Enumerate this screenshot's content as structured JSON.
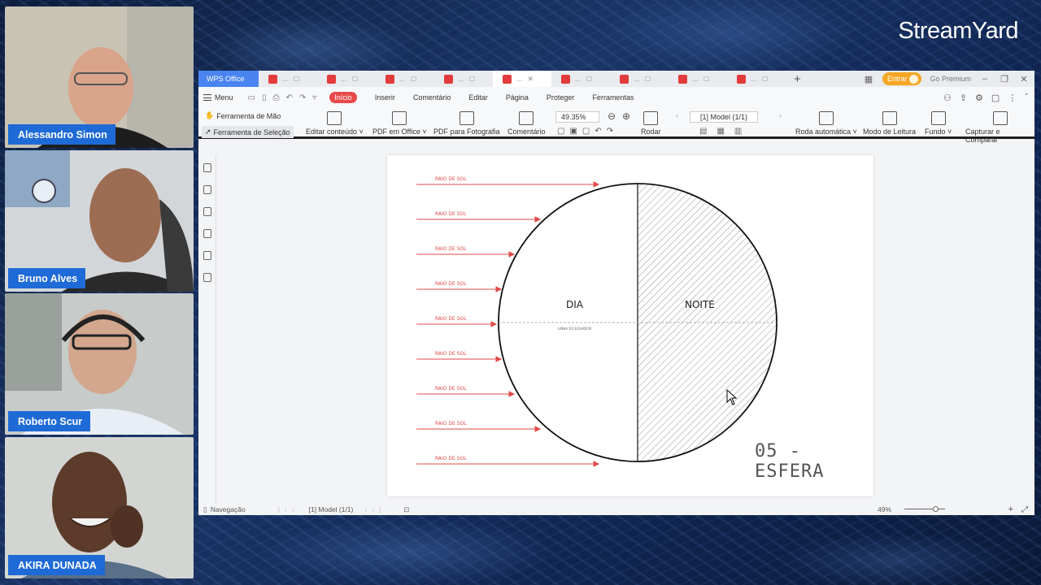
{
  "brand": "StreamYard",
  "participants": [
    {
      "name": "Alessandro Simon"
    },
    {
      "name": "Bruno Alves"
    },
    {
      "name": "Roberto Scur"
    },
    {
      "name": "AKIRA DUNADA"
    }
  ],
  "wps": {
    "app_tab": "WPS Office",
    "doc_tab_placeholder": "...",
    "right": {
      "login": "Entrar",
      "premium": "Go Premium"
    },
    "menu": {
      "label": "Menu",
      "tabs": [
        "Início",
        "Inserir",
        "Comentário",
        "Editar",
        "Página",
        "Proteger",
        "Ferramentas"
      ],
      "active_tab": "Início"
    },
    "toolbar": {
      "hand_tool": "Ferramenta de Mão",
      "select_tool": "Ferramenta de Seleção",
      "edit_content": "Editar conteúdo ˅",
      "pdf_to_office": "PDF em Office ˅",
      "pdf_to_photo": "PDF para Fotografia",
      "comment": "Comentário",
      "zoom": "49.35%",
      "rotate": "Rodar",
      "page_indicator": "[1] Model (1/1)",
      "auto_scroll": "Roda automática ˅",
      "read_mode": "Modo de Leitura",
      "background": "Fundo ˅",
      "capture": "Capturar e Comparar"
    },
    "drawing": {
      "ray_label": "RAIO DE SOL",
      "day": "DIA",
      "night": "NOITE",
      "equator": "LINHA DO EQUADOR",
      "title": "05 - ESFERA"
    },
    "status": {
      "navigation": "Navegação",
      "page": "[1] Model (1/1)",
      "zoom": "49%"
    }
  }
}
